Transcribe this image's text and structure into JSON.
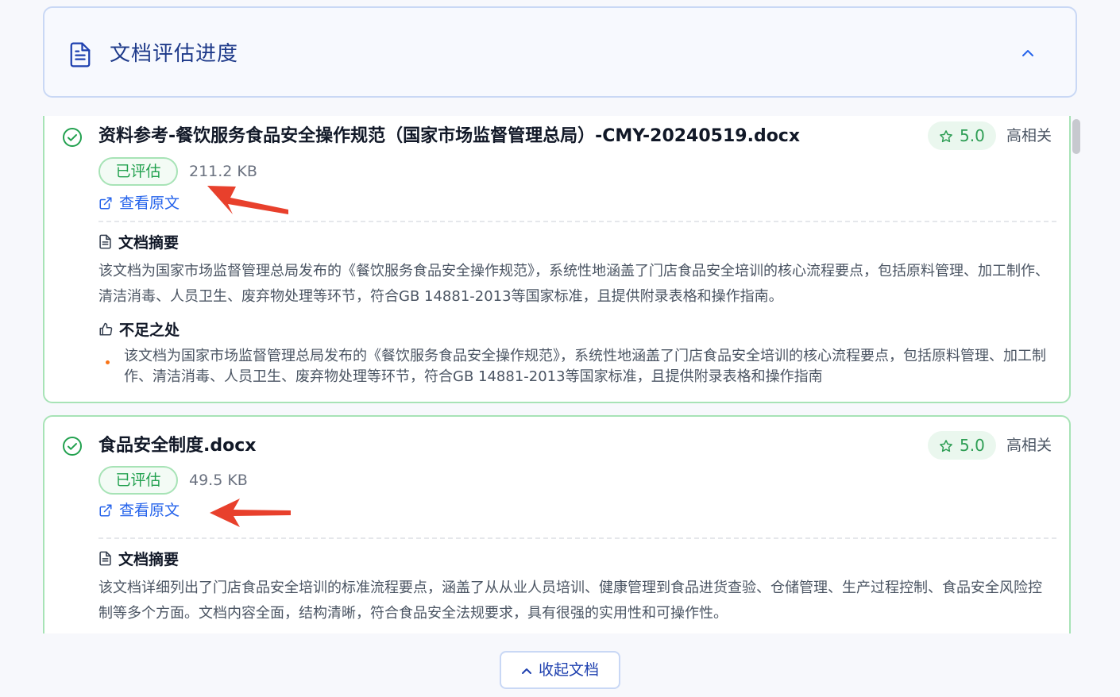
{
  "header": {
    "title": "文档评估进度"
  },
  "documents": [
    {
      "filename": "资料参考-餐饮服务食品安全操作规范（国家市场监督管理总局）-CMY-20240519.docx",
      "status": "已评估",
      "size": "211.2 KB",
      "view_link": "查看原文",
      "score": "5.0",
      "relevance": "高相关",
      "summary_title": "文档摘要",
      "summary": "该文档为国家市场监督管理总局发布的《餐饮服务食品安全操作规范》，系统性地涵盖了门店食品安全培训的核心流程要点，包括原料管理、加工制作、清洁消毒、人员卫生、废弃物处理等环节，符合GB 14881-2013等国家标准，且提供附录表格和操作指南。",
      "weakness_title": "不足之处",
      "weaknesses": [
        "该文档为国家市场监督管理总局发布的《餐饮服务食品安全操作规范》，系统性地涵盖了门店食品安全培训的核心流程要点，包括原料管理、加工制作、清洁消毒、人员卫生、废弃物处理等环节，符合GB 14881-2013等国家标准，且提供附录表格和操作指南"
      ]
    },
    {
      "filename": "食品安全制度.docx",
      "status": "已评估",
      "size": "49.5 KB",
      "view_link": "查看原文",
      "score": "5.0",
      "relevance": "高相关",
      "summary_title": "文档摘要",
      "summary": "该文档详细列出了门店食品安全培训的标准流程要点，涵盖了从从业人员培训、健康管理到食品进货查验、仓储管理、生产过程控制、食品安全风险控制等多个方面。文档内容全面，结构清晰，符合食品安全法规要求，具有很强的实用性和可操作性。"
    }
  ],
  "collapse_button": "收起文档",
  "colors": {
    "accent": "#2563eb",
    "success": "#22a14f",
    "success_border": "#a7e3b6",
    "annotation_arrow": "#e8402c",
    "bullet": "#f97316"
  }
}
